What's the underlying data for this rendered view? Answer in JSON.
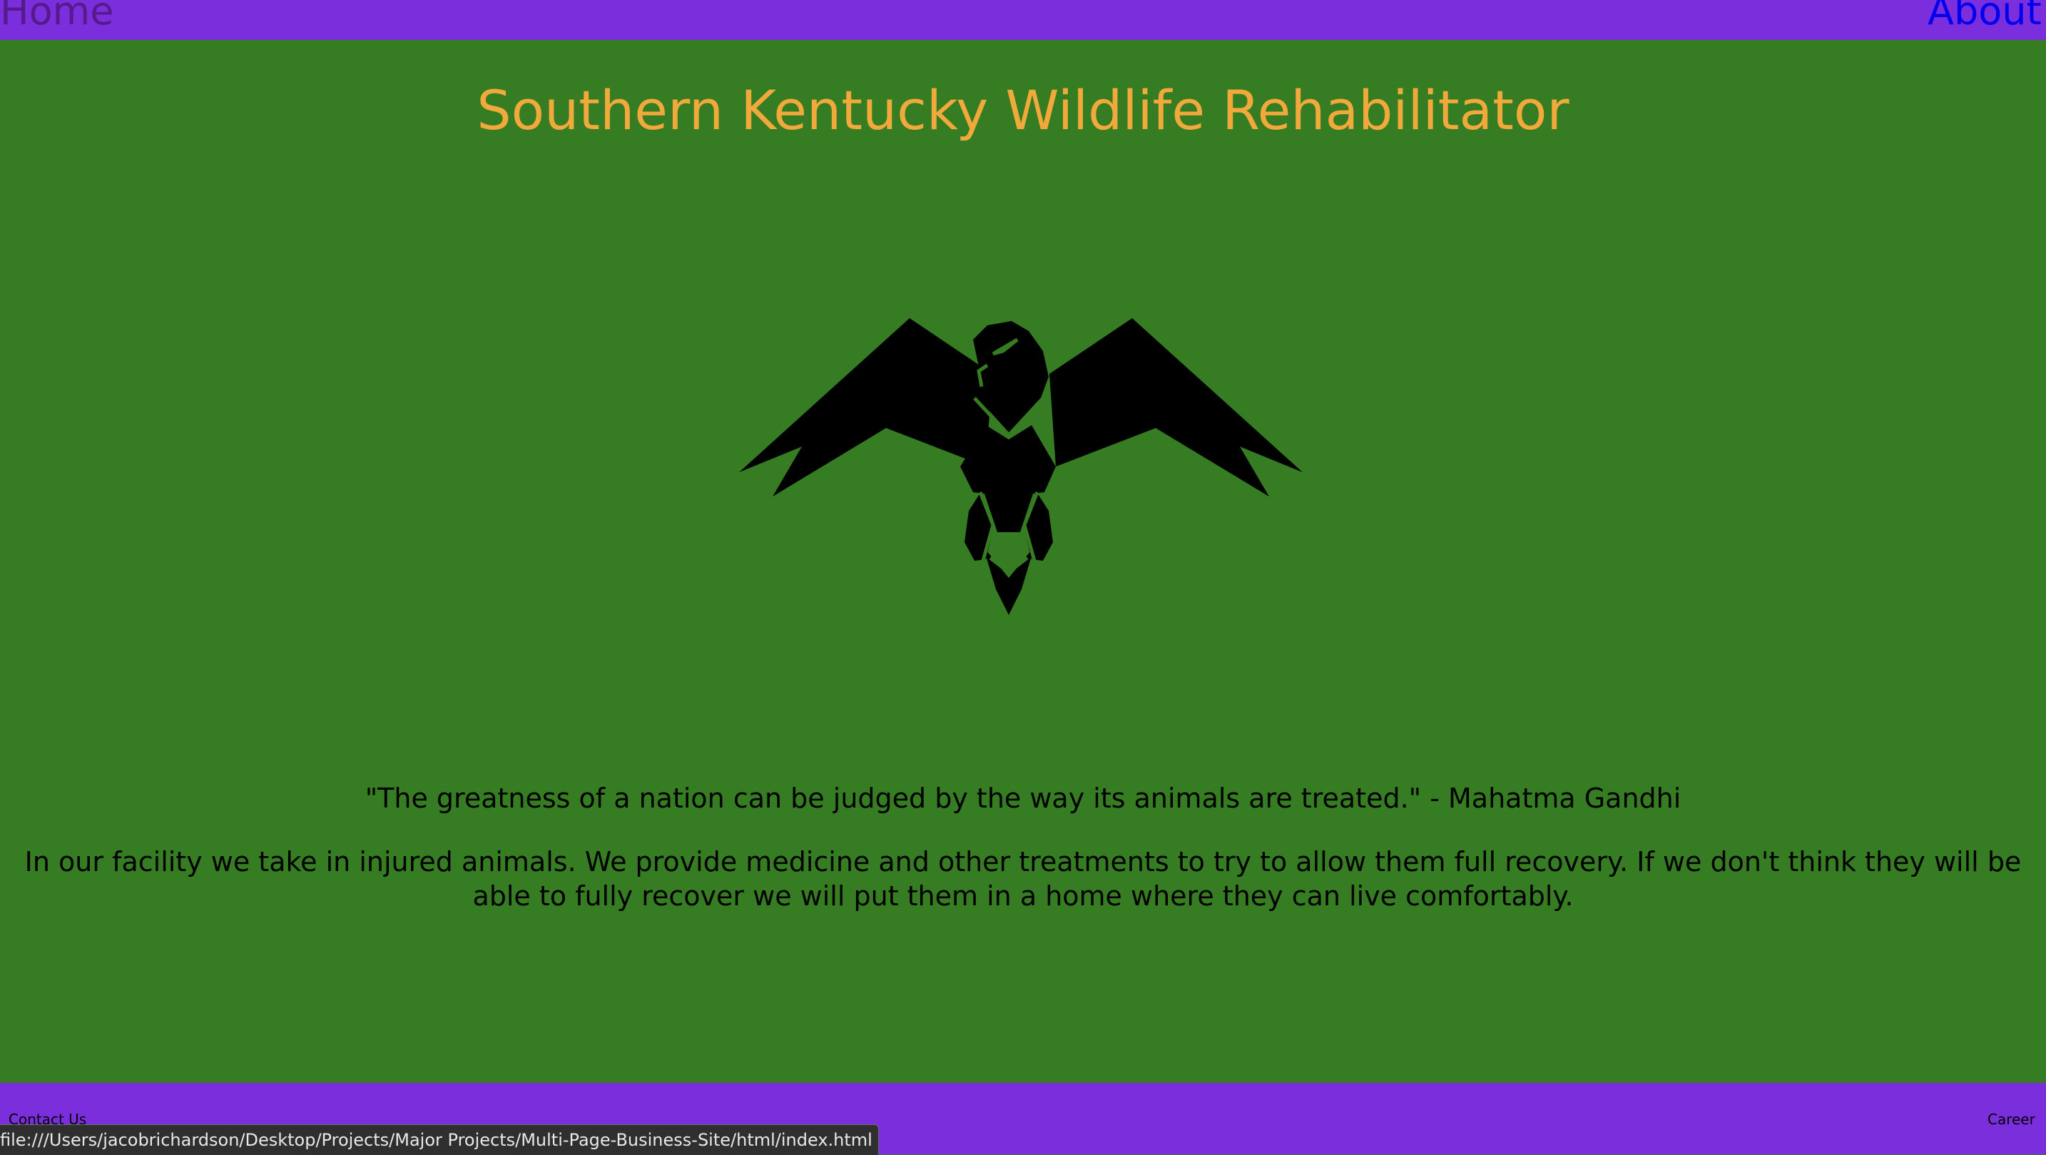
{
  "nav": {
    "home_label": "Home",
    "about_label": "About",
    "background": "#7b2fdc",
    "visited_link_color": "#551a8b",
    "link_color": "#0000ee"
  },
  "main": {
    "title": "Southern Kentucky Wildlife Rehabilitator",
    "title_color": "#f0a93a",
    "background": "#367c22",
    "logo_icon": "eagle-icon",
    "quote": "\"The greatness of a nation can be judged by the way its animals are treated.\" - Mahatma Gandhi",
    "description": "In our facility we take in injured animals. We provide medicine and other treatments to try to allow them full recovery. If we don't think they will be able to fully recover we will put them in a home where they can live comfortably."
  },
  "footer": {
    "contact_label": "Contact Us",
    "career_label": "Career"
  },
  "status_bar": {
    "url": "file:///Users/jacobrichardson/Desktop/Projects/Major Projects/Multi-Page-Business-Site/html/index.html"
  }
}
